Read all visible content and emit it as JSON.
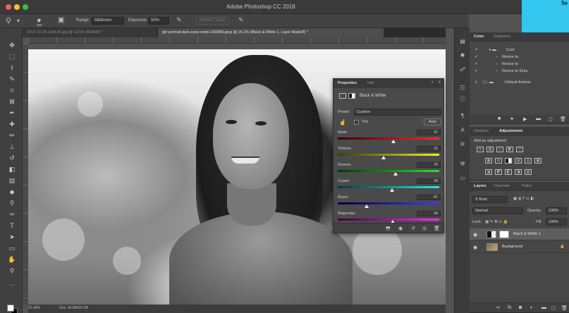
{
  "window": {
    "title": "Adobe Photoshop CC 2018",
    "corner_text": "5e"
  },
  "options_bar": {
    "brush_size": "350",
    "range_label": "Range:",
    "range_value": "Midtones",
    "exposure_label": "Exposure:",
    "exposure_value": "50%",
    "protect_tones_label": "Protect Tones"
  },
  "tabs": [
    {
      "label": "2017-10-29 1145.30.jpg @ 12.5% (RGB/8) *"
    },
    {
      "label": "girl-portrait-dark-eyes-smile-160959.jpeg @ 25.1% (Black & White 1, Layer Mask/8) *"
    }
  ],
  "properties": {
    "tab_properties": "Properties",
    "tab_info": "Info",
    "adjustment_name": "Black & White",
    "preset_label": "Preset:",
    "preset_value": "Custom",
    "tint_label": "Tint",
    "auto_label": "Auto",
    "sliders": [
      {
        "label": "Reds:",
        "value": "67"
      },
      {
        "label": "Yellows:",
        "value": "21"
      },
      {
        "label": "Greens:",
        "value": "75"
      },
      {
        "label": "Cyans:",
        "value": "56"
      },
      {
        "label": "Blues:",
        "value": "-87"
      },
      {
        "label": "Magentas:",
        "value": "59"
      }
    ]
  },
  "color_panel": {
    "tab_color": "Color",
    "tab_swatches": "Swatches"
  },
  "actions": {
    "rows": [
      {
        "label": "Cust"
      },
      {
        "label": "Resize to"
      },
      {
        "label": "Resize to"
      },
      {
        "label": "Resize to 22px"
      },
      {
        "label": "Default Actions"
      }
    ]
  },
  "libraries": {
    "tab_libraries": "Libraries",
    "tab_adjustments": "Adjustments",
    "add_adjustment": "Add an adjustment"
  },
  "layers": {
    "tab_layers": "Layers",
    "tab_channels": "Channels",
    "tab_paths": "Paths",
    "kind_label": "Kind",
    "blend_mode": "Normal",
    "opacity_label": "Opacity:",
    "opacity_value": "100%",
    "lock_label": "Lock:",
    "fill_label": "Fill:",
    "fill_value": "100%",
    "items": [
      {
        "name": "Black & White 1"
      },
      {
        "name": "Background"
      }
    ]
  },
  "status_bar": {
    "zoom": "25.06%",
    "doc": "Doc: 30.8M/29.2M"
  },
  "icons": {
    "move": "move-icon",
    "eye": "eye-icon"
  },
  "colors": {
    "accent": "#33c6ef",
    "panel_bg": "#474747",
    "workspace_bg": "#535353"
  }
}
